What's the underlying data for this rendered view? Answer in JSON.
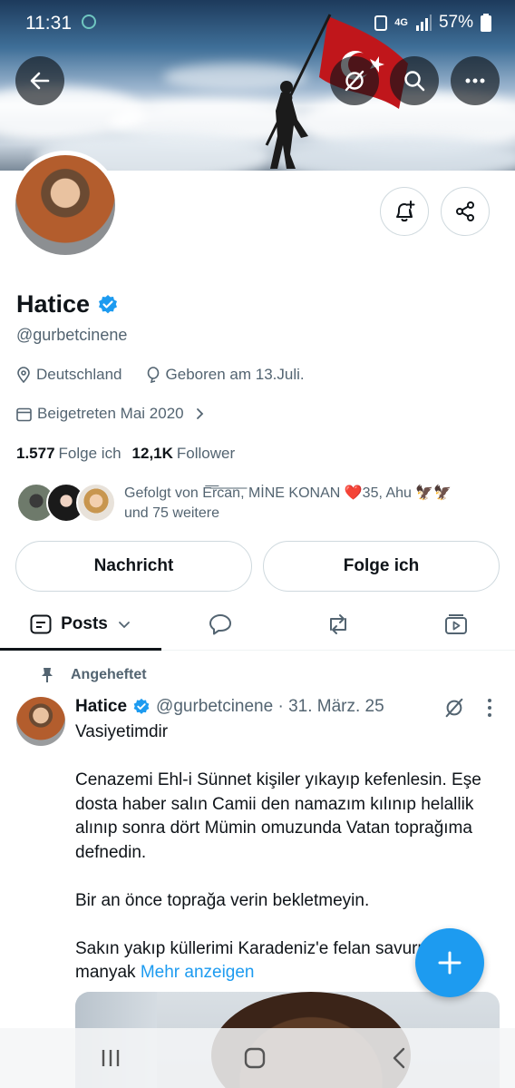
{
  "status_bar": {
    "time": "11:31",
    "network": "4G",
    "battery": "57%"
  },
  "profile": {
    "name": "Hatice",
    "handle": "@gurbetcinene",
    "location": "Deutschland",
    "birthday": "Geboren am 13.Juli.",
    "joined": "Beigetreten Mai 2020",
    "following_count": "1.577",
    "following_label": "Folge ich",
    "followers_count": "12,1K",
    "followers_label": "Follower",
    "followed_by_line1": "Gefolgt von E͞r͞c͞a͞n͞, MİNE KONAN ❤️35, Ahu 🦅🦅",
    "followed_by_line2": "und 75 weitere"
  },
  "actions": {
    "message_label": "Nachricht",
    "follow_label": "Folge ich"
  },
  "tabs": {
    "posts_label": "Posts"
  },
  "post": {
    "pinned_label": "Angeheftet",
    "author": "Hatice",
    "meta": "@gurbetcinene · 31. März. 25",
    "text": "Vasiyetimdir\n\nCenazemi Ehl-i Sünnet kişiler yıkayıp kefenlesin. Eşe dosta haber salın Camii den namazım kılınıp helallik alınıp sonra dört Mümin omuzunda Vatan toprağıma defnedin.\n\nBir an önce toprağa verin bekletmeyin.\n\nSakın yakıp küllerimi Karadeniz'e felan savurun",
    "text_end": "manyak ",
    "show_more": "Mehr anzeigen"
  },
  "colors": {
    "accent": "#1d9bf0",
    "text": "#0f1419",
    "secondary": "#536471",
    "border": "#cfd9de"
  },
  "icons": [
    "back-arrow-icon",
    "grok-icon",
    "search-icon",
    "more-icon",
    "bell-plus-icon",
    "share-icon",
    "location-icon",
    "balloon-icon",
    "calendar-icon",
    "chevron-right-icon",
    "posts-tab-icon",
    "replies-tab-icon",
    "retweet-tab-icon",
    "media-tab-icon",
    "pin-icon",
    "verified-badge-icon",
    "compose-plus-icon"
  ]
}
